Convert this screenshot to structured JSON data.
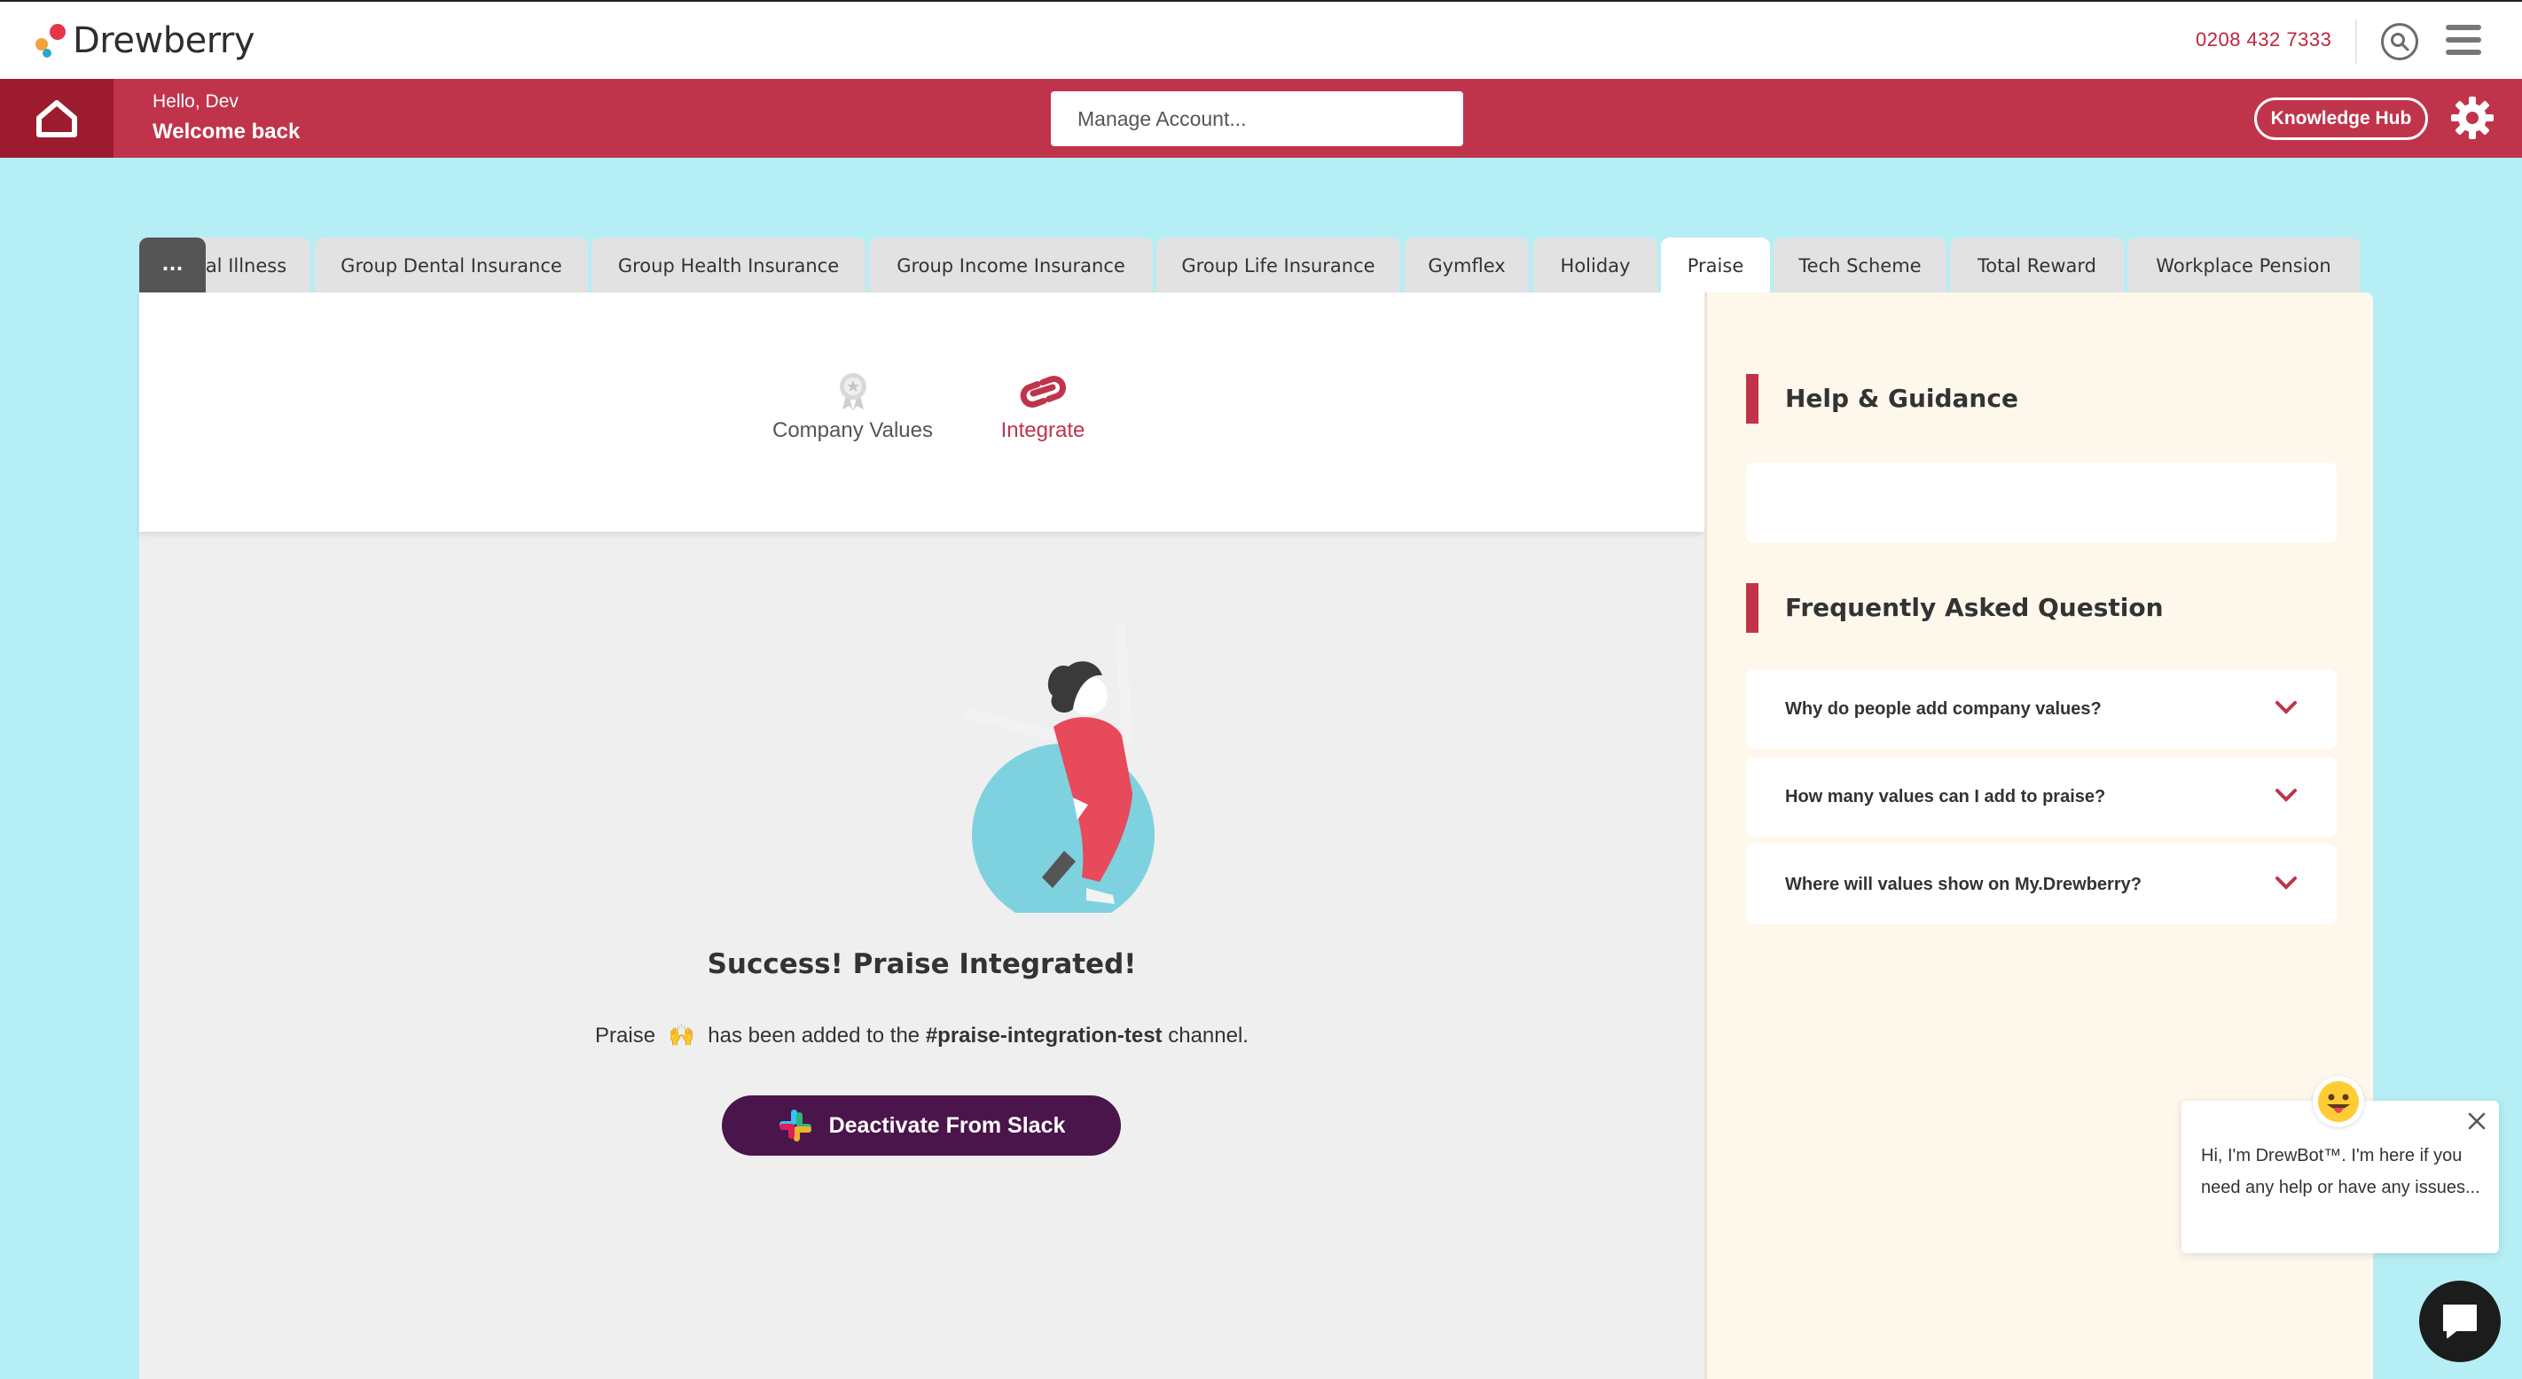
{
  "header": {
    "brand": "Drewberry",
    "phone": "0208 432 7333",
    "icons": {
      "search": "search-icon",
      "menu": "hamburger-menu-icon"
    }
  },
  "nav": {
    "greeting": "Hello, Dev",
    "welcome": "Welcome back",
    "manage_placeholder": "Manage Account...",
    "knowledge_hub": "Knowledge Hub",
    "icons": {
      "home": "home-icon",
      "settings": "gear-icon"
    }
  },
  "tabs": {
    "more": "...",
    "items": [
      "al Illness",
      "Group Dental Insurance",
      "Group Health Insurance",
      "Group Income Insurance",
      "Group Life Insurance",
      "Gymflex",
      "Holiday",
      "Praise",
      "Tech Scheme",
      "Total Reward",
      "Workplace Pension"
    ],
    "active": "Praise"
  },
  "subnav": {
    "company_values": "Company Values",
    "integrate": "Integrate",
    "active": "Integrate"
  },
  "main": {
    "success_title": "Success! Praise Integrated!",
    "msg_prefix": "Praise",
    "msg_emoji": "🙌",
    "msg_middle": "has been added to the",
    "msg_channel": "#praise-integration-test",
    "msg_suffix": "channel.",
    "slack_button": "Deactivate From Slack"
  },
  "help": {
    "title": "Help & Guidance",
    "faq_title": "Frequently Asked Question",
    "faqs": [
      "Why do people add company values?",
      "How many values can I add to praise?",
      "Where will values show on My.Drewberry?"
    ]
  },
  "chat": {
    "message": "Hi, I'm DrewBot™. I'm here if you need any help or have any issues...",
    "emoji": "😛"
  },
  "colors": {
    "brand_red": "#c0344b",
    "dark_red": "#9c1b2e",
    "slack_purple": "#4a154b",
    "background_teal": "#b6eef5",
    "help_panel": "#fdf8eb"
  }
}
